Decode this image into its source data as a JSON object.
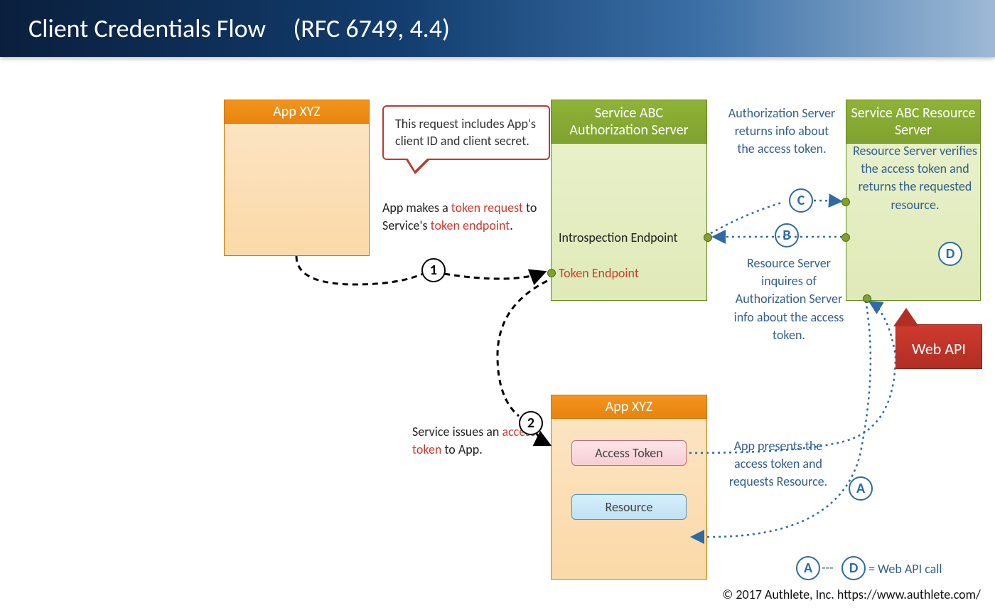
{
  "title": {
    "main": "Client Credentials Flow",
    "rfc": "(RFC 6749, 4.4)"
  },
  "boxes": {
    "app_top": {
      "title": "App XYZ"
    },
    "auth_srv": {
      "title": "Service ABC Authorization Server",
      "ep_introspect": "Introspection Endpoint",
      "ep_token": "Token Endpoint"
    },
    "res_srv": {
      "title": "Service ABC Resource Server"
    },
    "app_bottom": {
      "title": "App XYZ",
      "chip_token": "Access Token",
      "chip_resource": "Resource"
    },
    "webapi": "Web API"
  },
  "bubble": "This request includes App's client ID and client secret.",
  "labels": {
    "step1": {
      "pre": "App makes a ",
      "hi1": "token request",
      "mid": " to Service's ",
      "hi2": "token endpoint",
      "post": "."
    },
    "step2": {
      "pre": "Service issues an ",
      "hi": "access token",
      "post": " to App."
    },
    "c_text": "Authorization Server returns info about the access token.",
    "b_text": "Resource Server inquires of Authorization Server info about the access token.",
    "d_text": "Resource Server verifies the access token and returns the requested resource.",
    "a_text": "App presents the access token and requests Resource.",
    "legend": " = Web API call"
  },
  "steps": {
    "one": "1",
    "two": "2"
  },
  "letters": {
    "a": "A",
    "b": "B",
    "c": "C",
    "d": "D"
  },
  "footer": "© 2017 Authlete, Inc.  https://www.authlete.com/"
}
